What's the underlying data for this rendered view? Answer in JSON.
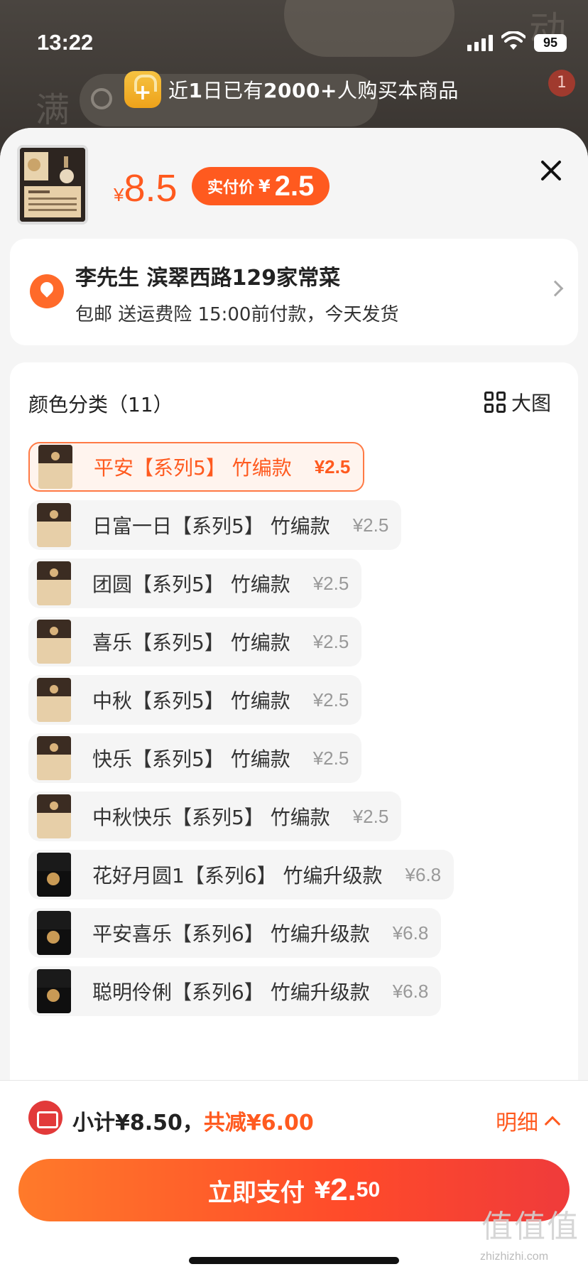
{
  "status": {
    "time": "13:22",
    "battery": "95"
  },
  "background": {
    "deco_left": "满",
    "deco_right": "动",
    "badge_count": "1"
  },
  "banner": {
    "prefix": "近",
    "num": "1",
    "mid": "日已有",
    "count": "2000+",
    "suffix": "人购买本商品"
  },
  "product": {
    "price_currency": "¥",
    "price": "8.5",
    "pay_label": "实付价",
    "pay_currency": "¥",
    "pay_price": "2.5"
  },
  "address": {
    "line1": "李先生 滨翠西路129家常菜",
    "line2": "包邮 送运费险 15:00前付款，今天发货"
  },
  "options": {
    "title": "颜色分类（11）",
    "big_view_label": "大图",
    "items": [
      {
        "name": "平安【系列5】 竹编款",
        "price": "¥2.5",
        "selected": true
      },
      {
        "name": "日富一日【系列5】 竹编款",
        "price": "¥2.5"
      },
      {
        "name": "团圆【系列5】 竹编款",
        "price": "¥2.5"
      },
      {
        "name": "喜乐【系列5】 竹编款",
        "price": "¥2.5"
      },
      {
        "name": "中秋【系列5】 竹编款",
        "price": "¥2.5"
      },
      {
        "name": "快乐【系列5】 竹编款",
        "price": "¥2.5"
      },
      {
        "name": "中秋快乐【系列5】 竹编款",
        "price": "¥2.5"
      },
      {
        "name": "花好月圆1【系列6】 竹编升级款",
        "price": "¥6.8"
      },
      {
        "name": "平安喜乐【系列6】 竹编升级款",
        "price": "¥6.8"
      },
      {
        "name": "聪明伶俐【系列6】 竹编升级款",
        "price": "¥6.8"
      }
    ]
  },
  "footer": {
    "subtotal": "小计¥8.50，",
    "discount": "共减¥6.00",
    "detail_label": "明细",
    "pay_label": "立即支付",
    "pay_currency": "¥",
    "pay_int": "2.",
    "pay_dec": "50"
  },
  "watermark": {
    "main": "值值值",
    "sub": "zhizhizhi.com"
  },
  "colors": {
    "accent": "#ff5a1f",
    "button_end": "#ef3b3b"
  }
}
